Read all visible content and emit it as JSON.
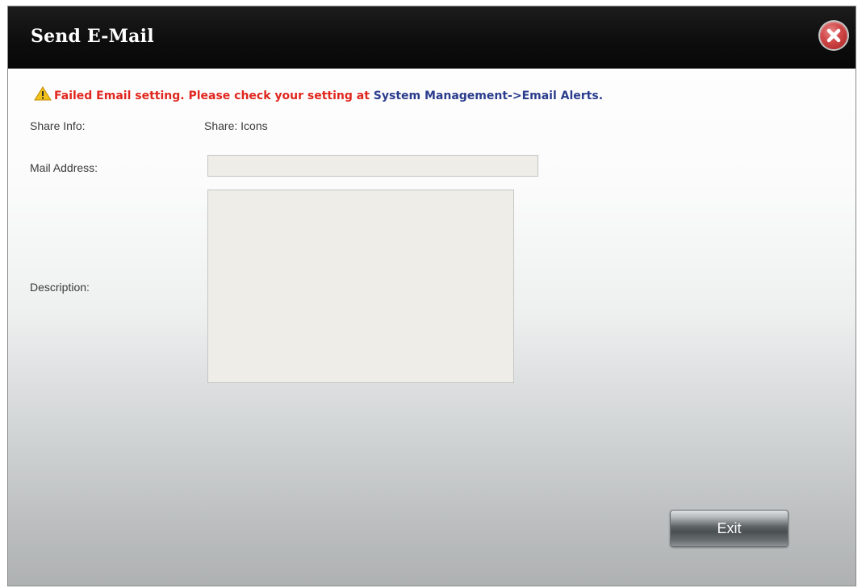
{
  "dialog": {
    "title": "Send E-Mail",
    "close_icon": "close-icon"
  },
  "alert": {
    "icon": "warning-icon",
    "message": "Failed Email setting. Please check your setting at ",
    "link_text": "System Management->Email Alerts.",
    "message_color": "#e0261e",
    "link_color": "#2a3c8c"
  },
  "form": {
    "share_info_label": "Share Info:",
    "share_info_value": "Share: Icons",
    "mail_address_label": "Mail Address:",
    "mail_address_value": "",
    "description_label": "Description:",
    "description_value": ""
  },
  "buttons": {
    "exit_label": "Exit"
  }
}
